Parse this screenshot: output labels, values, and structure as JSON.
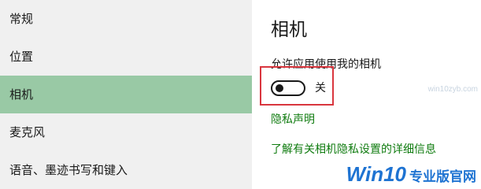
{
  "sidebar": {
    "items": [
      {
        "label": "常规"
      },
      {
        "label": "位置"
      },
      {
        "label": "相机"
      },
      {
        "label": "麦克风"
      },
      {
        "label": "语音、墨迹书写和键入"
      }
    ],
    "selected_index": 2,
    "selected_color": "#99c9a5"
  },
  "main": {
    "title": "相机",
    "setting_label": "允许应用使用我的相机",
    "toggle": {
      "state_label": "关",
      "is_on": false
    },
    "privacy_link": "隐私声明",
    "learn_more_link": "了解有关相机隐私设置的详细信息"
  },
  "overlay": {
    "watermark": "win10zyb.com",
    "logo_primary": "Win10",
    "logo_secondary": "专业版官网"
  },
  "colors": {
    "link": "#107c10",
    "highlight_border": "#d9363e"
  }
}
